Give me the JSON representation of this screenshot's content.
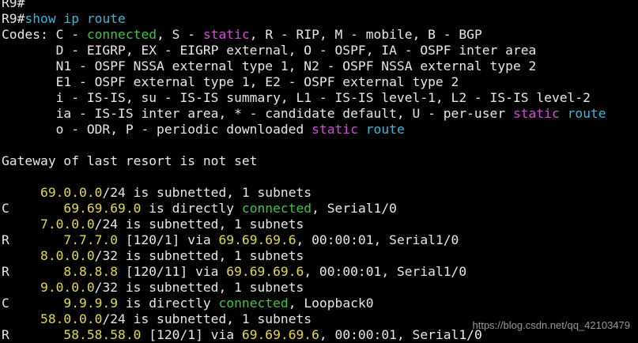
{
  "window": {
    "prompt": "R9#",
    "command": "show ip route",
    "colors": {
      "background": "#000000",
      "text": "#e6e6e6",
      "green": "#3ec43e",
      "magenta": "#d84ad8",
      "cyan": "#3ab6d6",
      "yellow": "#e0d84a"
    }
  },
  "terminal": {
    "lines": [
      {
        "segments": [
          {
            "text": "R9#",
            "color": "default"
          }
        ]
      },
      {
        "segments": [
          {
            "text": "R9#",
            "color": "default"
          },
          {
            "text": "show ip route",
            "color": "cyan"
          }
        ]
      },
      {
        "segments": [
          {
            "text": "Codes: C - ",
            "color": "default"
          },
          {
            "text": "connected",
            "color": "green"
          },
          {
            "text": ", S - ",
            "color": "default"
          },
          {
            "text": "static",
            "color": "magenta"
          },
          {
            "text": ", R - RIP, M - mobile, B - BGP",
            "color": "default"
          }
        ]
      },
      {
        "segments": [
          {
            "text": "       D - EIGRP, EX - EIGRP external, O - OSPF, IA - OSPF inter area",
            "color": "default"
          }
        ]
      },
      {
        "segments": [
          {
            "text": "       N1 - OSPF NSSA external type 1, N2 - OSPF NSSA external type 2",
            "color": "default"
          }
        ]
      },
      {
        "segments": [
          {
            "text": "       E1 - OSPF external type 1, E2 - OSPF external type 2",
            "color": "default"
          }
        ]
      },
      {
        "segments": [
          {
            "text": "       i - IS-IS, su - IS-IS summary, L1 - IS-IS level-1, L2 - IS-IS level-2",
            "color": "default"
          }
        ]
      },
      {
        "segments": [
          {
            "text": "       ia - IS-IS inter area, * - candidate default, U - per-user ",
            "color": "default"
          },
          {
            "text": "static",
            "color": "magenta"
          },
          {
            "text": " ",
            "color": "default"
          },
          {
            "text": "route",
            "color": "cyan"
          }
        ]
      },
      {
        "segments": [
          {
            "text": "       o - ODR, P - periodic downloaded ",
            "color": "default"
          },
          {
            "text": "static",
            "color": "magenta"
          },
          {
            "text": " ",
            "color": "default"
          },
          {
            "text": "route",
            "color": "cyan"
          }
        ]
      },
      {
        "segments": [
          {
            "text": " ",
            "color": "default"
          }
        ]
      },
      {
        "segments": [
          {
            "text": "Gateway of last resort is not set",
            "color": "default"
          }
        ]
      },
      {
        "segments": [
          {
            "text": " ",
            "color": "default"
          }
        ]
      },
      {
        "segments": [
          {
            "text": "     ",
            "color": "default"
          },
          {
            "text": "69.0.0.0",
            "color": "yellow"
          },
          {
            "text": "/24 is subnetted, 1 subnets",
            "color": "default"
          }
        ]
      },
      {
        "segments": [
          {
            "text": "C       ",
            "color": "default"
          },
          {
            "text": "69.69.69.0",
            "color": "yellow"
          },
          {
            "text": " is directly ",
            "color": "default"
          },
          {
            "text": "connected",
            "color": "green"
          },
          {
            "text": ", Serial1/0",
            "color": "default"
          }
        ]
      },
      {
        "segments": [
          {
            "text": "     ",
            "color": "default"
          },
          {
            "text": "7.0.0.0",
            "color": "yellow"
          },
          {
            "text": "/24 is subnetted, 1 subnets",
            "color": "default"
          }
        ]
      },
      {
        "segments": [
          {
            "text": "R       ",
            "color": "default"
          },
          {
            "text": "7.7.7.0",
            "color": "yellow"
          },
          {
            "text": " [120/1] via ",
            "color": "default"
          },
          {
            "text": "69.69.69.6",
            "color": "yellow"
          },
          {
            "text": ", 00:00:01, Serial1/0",
            "color": "default"
          }
        ]
      },
      {
        "segments": [
          {
            "text": "     ",
            "color": "default"
          },
          {
            "text": "8.0.0.0",
            "color": "yellow"
          },
          {
            "text": "/32 is subnetted, 1 subnets",
            "color": "default"
          }
        ]
      },
      {
        "segments": [
          {
            "text": "R       ",
            "color": "default"
          },
          {
            "text": "8.8.8.8",
            "color": "yellow"
          },
          {
            "text": " [120/11] via ",
            "color": "default"
          },
          {
            "text": "69.69.69.6",
            "color": "yellow"
          },
          {
            "text": ", 00:00:01, Serial1/0",
            "color": "default"
          }
        ]
      },
      {
        "segments": [
          {
            "text": "     ",
            "color": "default"
          },
          {
            "text": "9.0.0.0",
            "color": "yellow"
          },
          {
            "text": "/32 is subnetted, 1 subnets",
            "color": "default"
          }
        ]
      },
      {
        "segments": [
          {
            "text": "C       ",
            "color": "default"
          },
          {
            "text": "9.9.9.9",
            "color": "yellow"
          },
          {
            "text": " is directly ",
            "color": "default"
          },
          {
            "text": "connected",
            "color": "green"
          },
          {
            "text": ", Loopback0",
            "color": "default"
          }
        ]
      },
      {
        "segments": [
          {
            "text": "     ",
            "color": "default"
          },
          {
            "text": "58.0.0.0",
            "color": "yellow"
          },
          {
            "text": "/24 is subnetted, 1 subnets",
            "color": "default"
          }
        ]
      },
      {
        "segments": [
          {
            "text": "R       ",
            "color": "default"
          },
          {
            "text": "58.58.58.0",
            "color": "yellow"
          },
          {
            "text": " [120/1] via ",
            "color": "default"
          },
          {
            "text": "69.69.69.6",
            "color": "yellow"
          },
          {
            "text": ", 00:00:01, Serial1/0",
            "color": "default"
          }
        ]
      }
    ]
  },
  "watermark": {
    "text": "https://blog.csdn.net/qq_42103479"
  }
}
